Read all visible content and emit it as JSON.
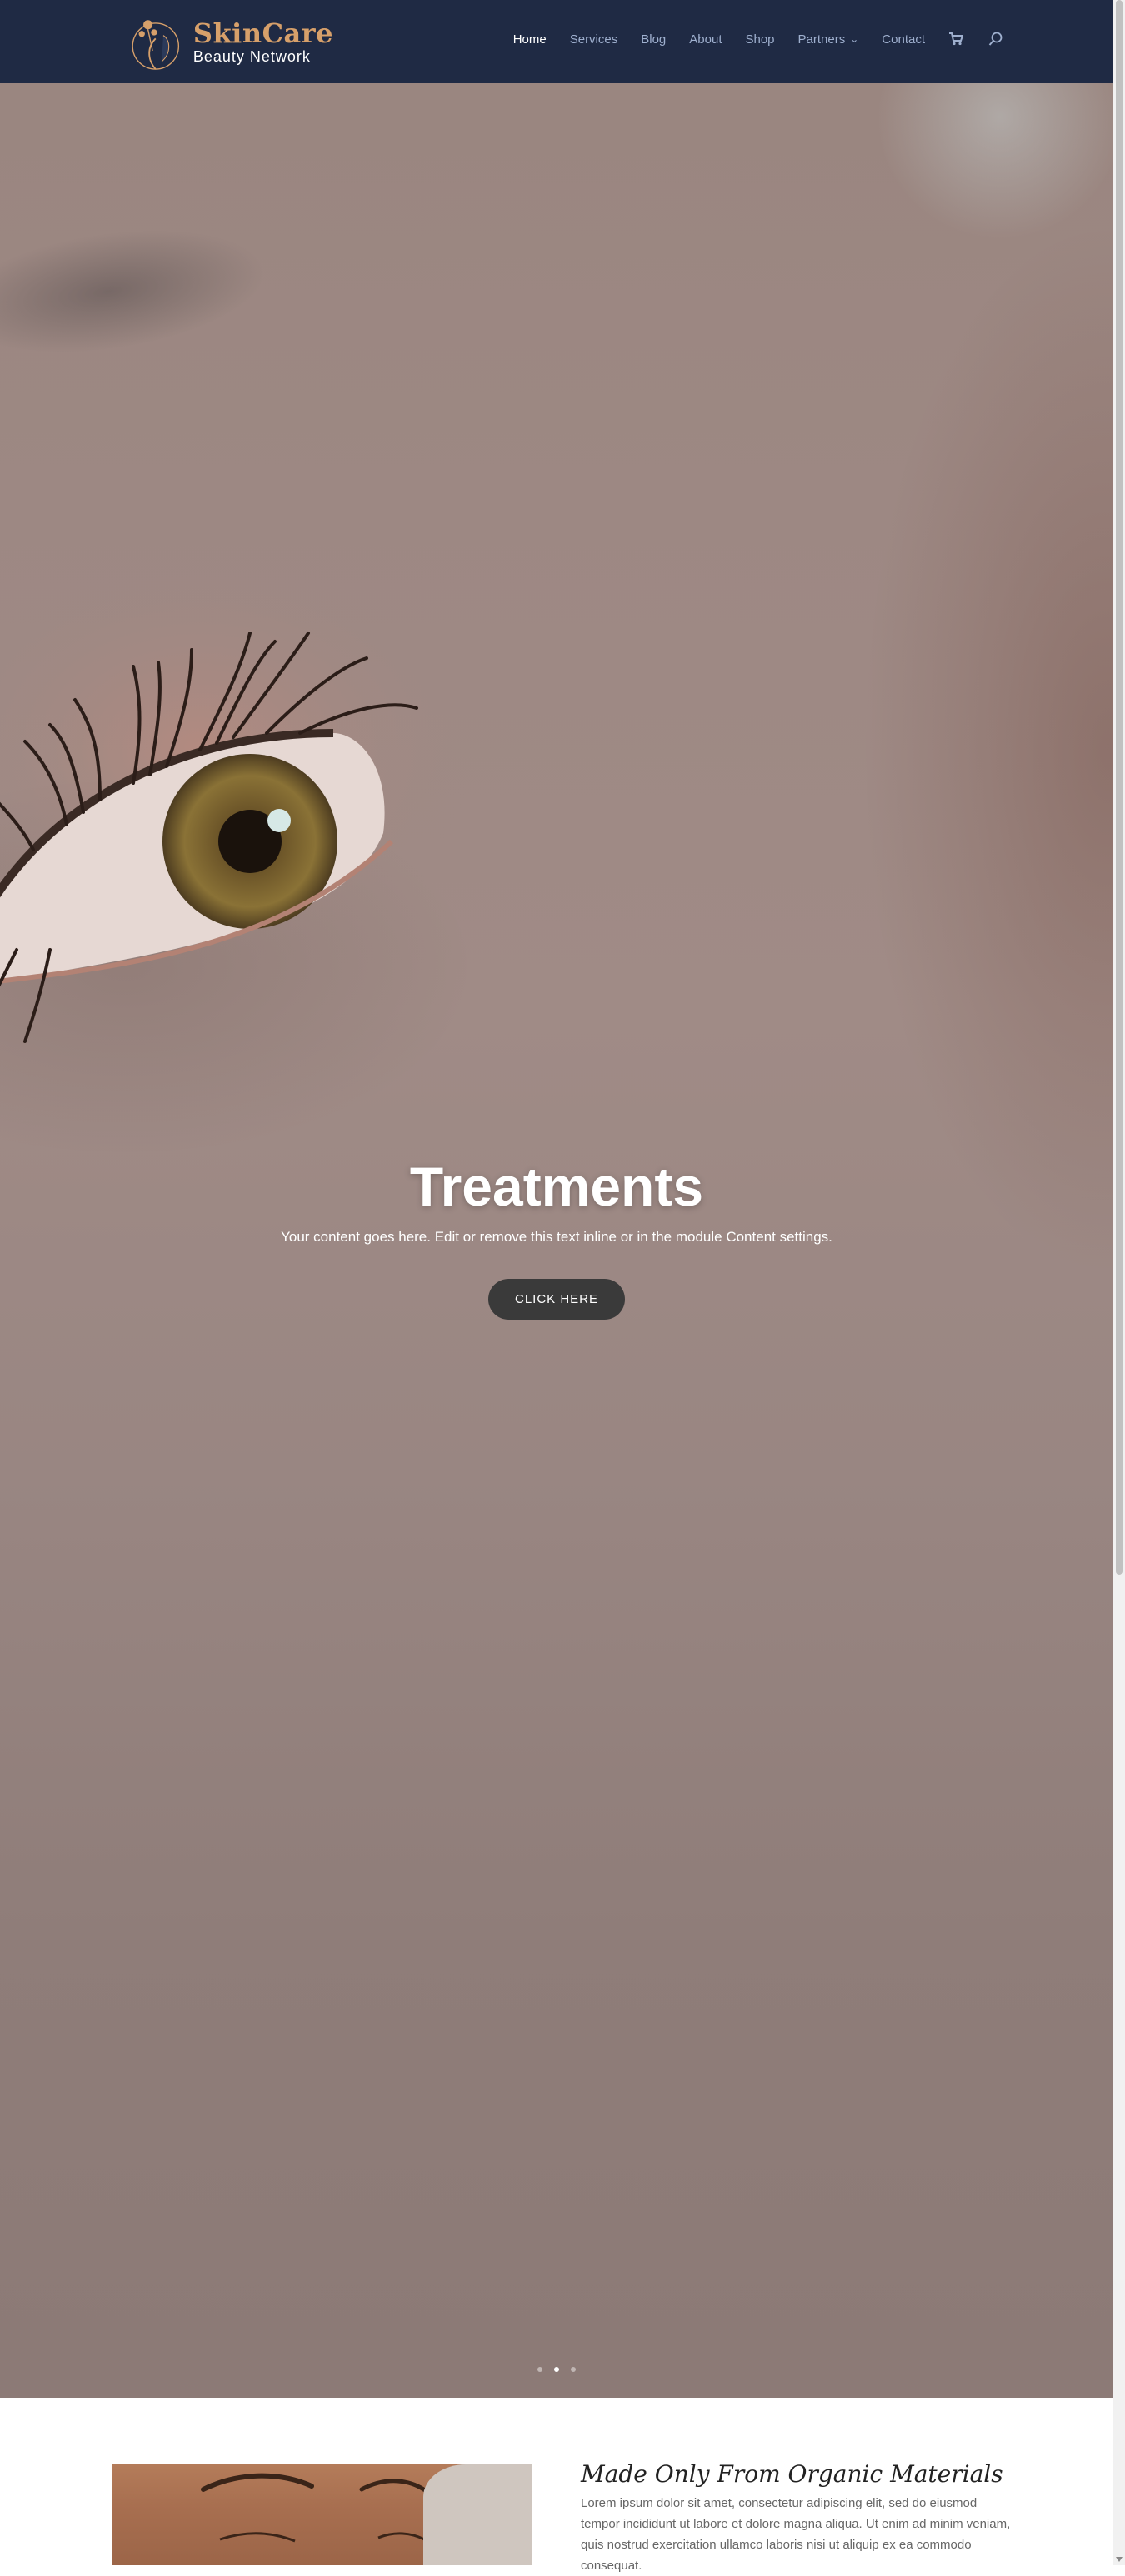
{
  "header": {
    "logo": {
      "title": "SkinCare",
      "subtitle": "Beauty Network"
    },
    "nav": [
      {
        "label": "Home",
        "active": true
      },
      {
        "label": "Services"
      },
      {
        "label": "Blog"
      },
      {
        "label": "About"
      },
      {
        "label": "Shop"
      },
      {
        "label": "Partners",
        "has_dropdown": true
      },
      {
        "label": "Contact"
      }
    ],
    "icons": {
      "cart": "cart-icon",
      "search": "search-icon",
      "dropdown": "chevron-down-icon"
    }
  },
  "hero": {
    "title": "Treatments",
    "text": "Your content goes here. Edit or remove this text inline or in the module Content settings.",
    "button_label": "CLICK HERE",
    "slides_count": 3,
    "active_slide": 2
  },
  "section": {
    "title": "Made Only From Organic Materials",
    "body": "Lorem ipsum dolor sit amet, consectetur adipiscing elit, sed do eiusmod tempor incididunt ut labore et dolore magna aliqua. Ut enim ad minim veniam, quis nostrud exercitation ullamco laboris nisi ut aliquip ex ea commodo consequat."
  },
  "colors": {
    "header_bg": "#1f2a44",
    "logo_accent": "#d7a06a",
    "nav_text": "#9fb0cf",
    "button_bg": "#3a3a3a"
  }
}
